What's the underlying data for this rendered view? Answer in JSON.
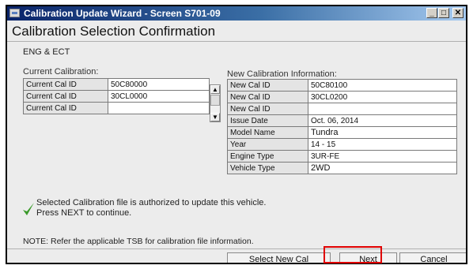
{
  "window": {
    "title": "Calibration Update Wizard - Screen S701-09",
    "minimize": "_",
    "maximize": "□",
    "close": "✕"
  },
  "header": {
    "title": "Calibration Selection Confirmation"
  },
  "system": "ENG & ECT",
  "current": {
    "label": "Current Calibration:",
    "rows": [
      {
        "label": "Current Cal ID",
        "value": "50C80000"
      },
      {
        "label": "Current Cal ID",
        "value": "30CL0000"
      },
      {
        "label": "Current Cal ID",
        "value": ""
      }
    ]
  },
  "new_info": {
    "label": "New Calibration Information:",
    "rows": [
      {
        "label": "New Cal ID",
        "value": "50C80100"
      },
      {
        "label": "New Cal ID",
        "value": "30CL0200"
      },
      {
        "label": "New Cal ID",
        "value": ""
      },
      {
        "label": "Issue Date",
        "value": "Oct. 06, 2014"
      },
      {
        "label": "Model Name",
        "value": "Tundra"
      },
      {
        "label": "Year",
        "value": "14 - 15"
      },
      {
        "label": "Engine Type",
        "value": "3UR-FE"
      },
      {
        "label": "Vehicle Type",
        "value": "2WD"
      }
    ]
  },
  "message": {
    "line1": "Selected Calibration file is authorized to update this vehicle.",
    "line2": "Press NEXT to continue."
  },
  "note": "NOTE: Refer the applicable TSB for calibration file information.",
  "buttons": {
    "select_new_cal": "Select New Cal",
    "next": "Next",
    "cancel": "Cancel"
  },
  "colors": {
    "title_bar": "#0a246a",
    "check": "#3a9a2a",
    "highlight": "#e00000"
  },
  "icons": {
    "status": "check-icon",
    "scroll_up": "up-arrow-icon",
    "scroll_down": "down-arrow-icon"
  }
}
